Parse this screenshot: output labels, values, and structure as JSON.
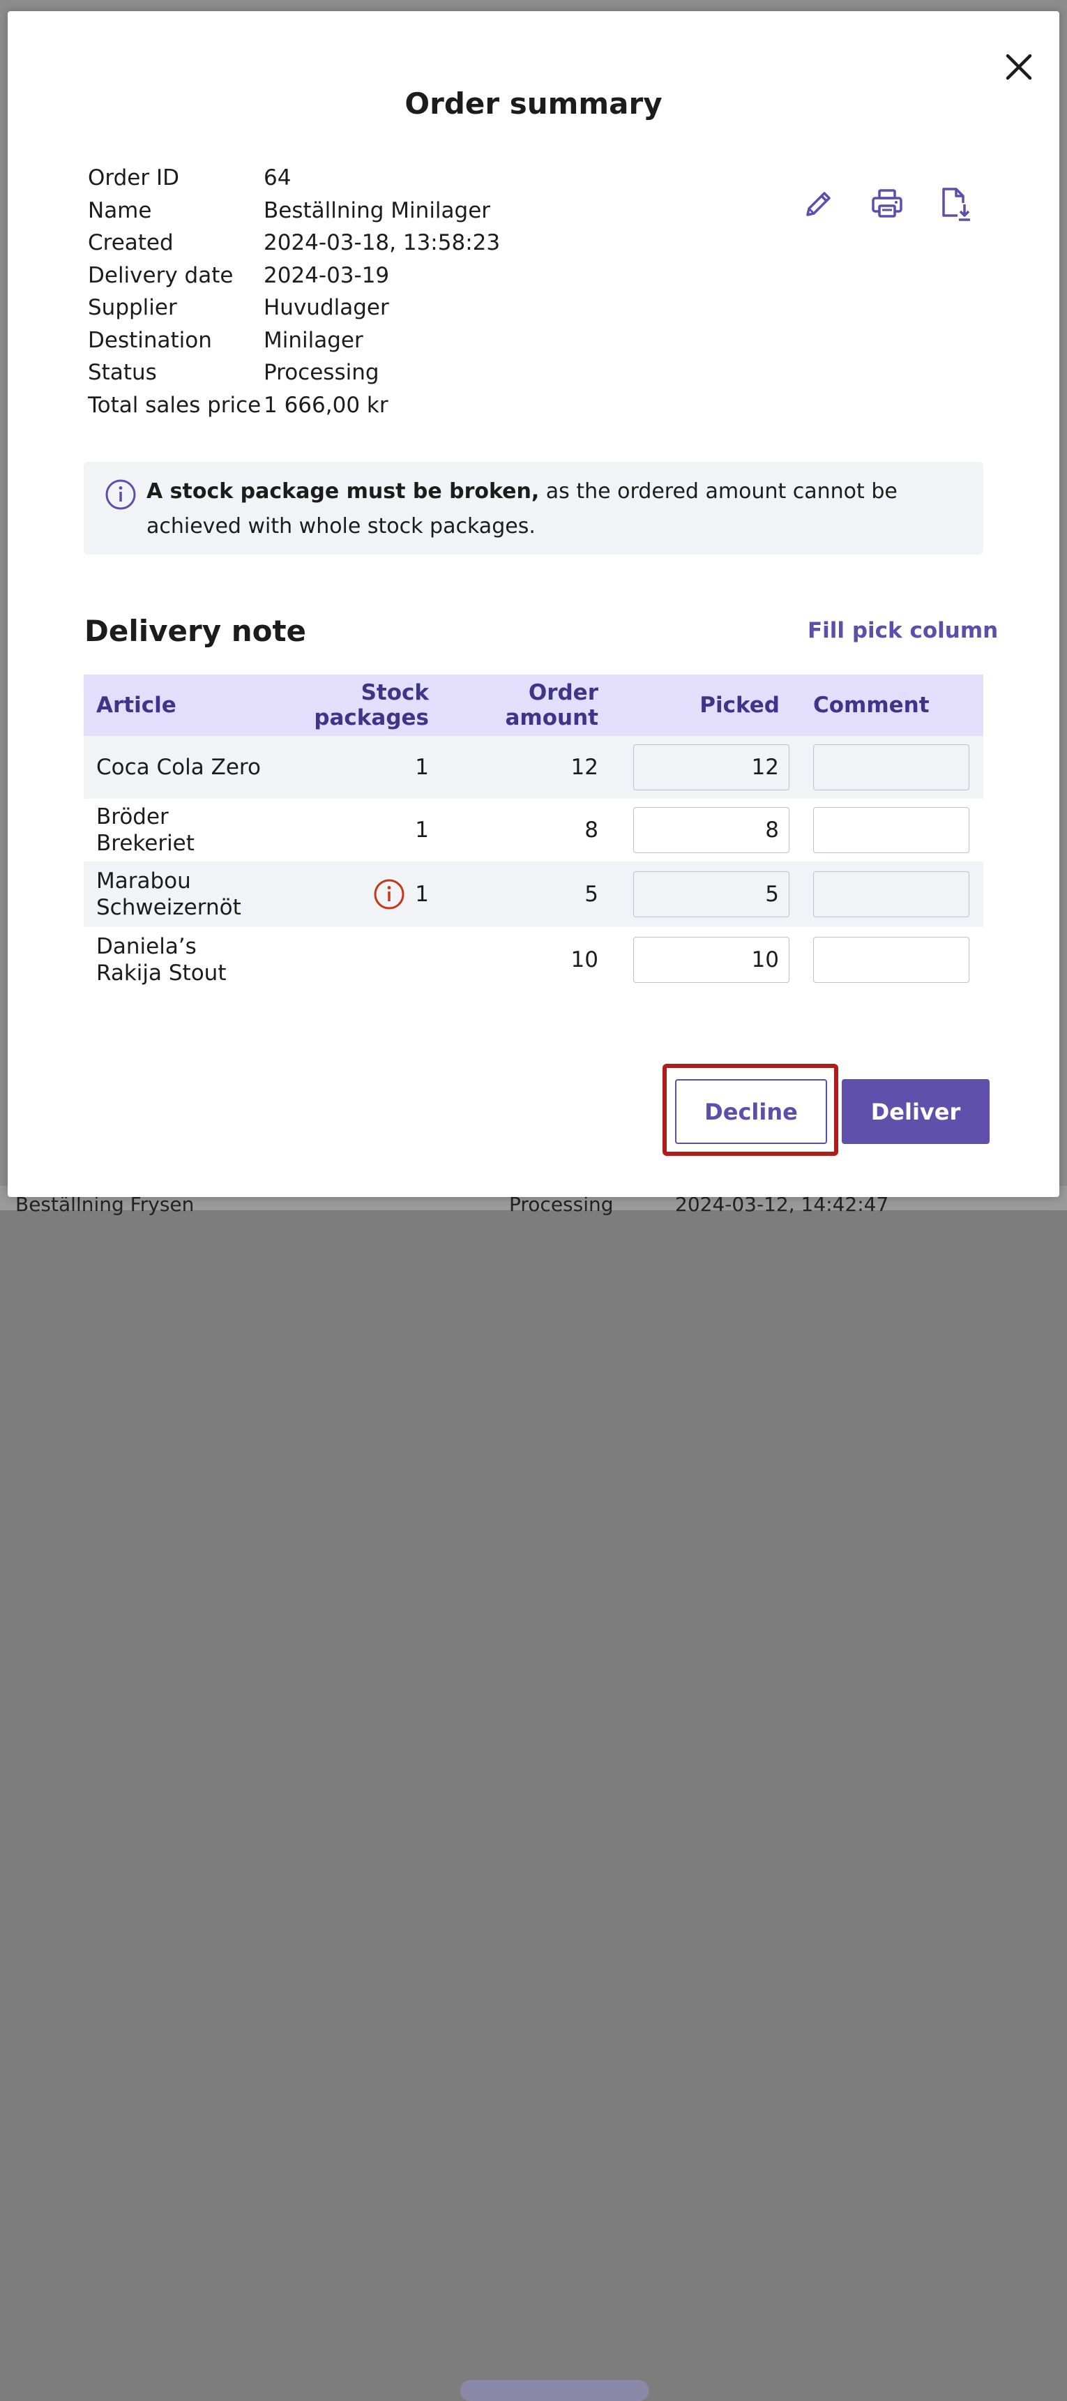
{
  "background": {
    "row_name": "Beställning Frysen",
    "row_status": "Processing",
    "row_date": "2024-03-12, 14:42:47"
  },
  "modal": {
    "title": "Order summary",
    "close_icon": "close-icon",
    "details": [
      {
        "label": "Order ID",
        "value": "64"
      },
      {
        "label": "Name",
        "value": "Beställning Minilager"
      },
      {
        "label": "Created",
        "value": "2024-03-18, 13:58:23"
      },
      {
        "label": "Delivery date",
        "value": "2024-03-19"
      },
      {
        "label": "Supplier",
        "value": "Huvudlager"
      },
      {
        "label": "Destination",
        "value": "Minilager"
      },
      {
        "label": "Status",
        "value": "Processing"
      },
      {
        "label": "Total sales price",
        "value": "1 666,00 kr"
      }
    ],
    "actions": [
      "pencil-icon",
      "printer-icon",
      "file-download-icon"
    ],
    "info": {
      "bold": "A stock package must be broken,",
      "text": " as the ordered amount cannot be achieved with whole stock packages."
    }
  },
  "delivery_note": {
    "title": "Delivery note",
    "fill_link": "Fill pick column",
    "columns": [
      "Article",
      "Stock packages",
      "Order amount",
      "Picked",
      "Comment"
    ],
    "rows": [
      {
        "article": "Coca Cola Zero",
        "packages": "1",
        "order_amount": "12",
        "picked": "12",
        "comment": "",
        "warning": false
      },
      {
        "article": "Bröder Brekeriet",
        "packages": "1",
        "order_amount": "8",
        "picked": "8",
        "comment": "",
        "warning": false
      },
      {
        "article": "Marabou Schweizernöt",
        "packages": "1",
        "order_amount": "5",
        "picked": "5",
        "comment": "",
        "warning": true
      },
      {
        "article": "Daniela’s Rakija Stout",
        "packages": "",
        "order_amount": "10",
        "picked": "10",
        "comment": "",
        "warning": false
      }
    ]
  },
  "buttons": {
    "decline": "Decline",
    "deliver": "Deliver"
  },
  "colors": {
    "accent": "#5b4fae",
    "header_bg": "#e2defb",
    "highlight": "#b01c1c",
    "warning": "#c0391b"
  }
}
